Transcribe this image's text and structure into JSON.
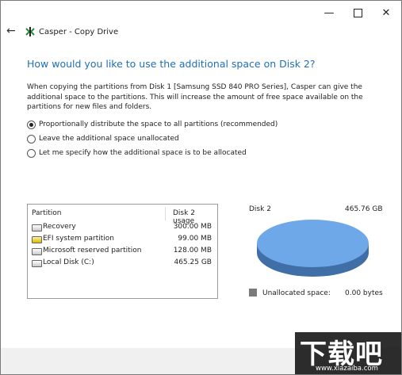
{
  "window": {
    "app_name": "Casper",
    "page_title": "Copy Drive",
    "title_separator": " - ",
    "minimize_glyph": "—",
    "close_glyph": "✕"
  },
  "nav": {
    "back_glyph": "←"
  },
  "heading": "How would you like to use the additional space on Disk 2?",
  "description": "When copying the partitions from Disk 1 [Samsung SSD 840 PRO Series], Casper can give the additional space to the partitions. This will increase the amount of free space available on the partitions for new files and folders.",
  "options": [
    {
      "label": "Proportionally distribute the space to all partitions (recommended)",
      "checked": true
    },
    {
      "label": "Leave the additional space unallocated",
      "checked": false
    },
    {
      "label": "Let me specify how the additional space is to be allocated",
      "checked": false
    }
  ],
  "partition_table": {
    "col_partition": "Partition",
    "col_usage": "Disk 2 usage",
    "rows": [
      {
        "name": "Recovery",
        "size": "300.00 MB",
        "icon": "drive-icon"
      },
      {
        "name": "EFI system partition",
        "size": "99.00 MB",
        "icon": "efi-drive-icon"
      },
      {
        "name": "Microsoft reserved partition",
        "size": "128.00 MB",
        "icon": "drive-icon"
      },
      {
        "name": "Local Disk (C:)",
        "size": "465.25 GB",
        "icon": "drive-icon"
      }
    ]
  },
  "disk": {
    "label": "Disk 2",
    "size": "465.76 GB",
    "unallocated_label": "Unallocated space:",
    "unallocated_value": "0.00 bytes",
    "pie_color": "#6fa8e8",
    "pie_side_color": "#3f6fa6",
    "unallocated_color": "#7b7b7b"
  },
  "watermark": {
    "text": "下载吧",
    "url": "www.xiazaiba.com"
  }
}
